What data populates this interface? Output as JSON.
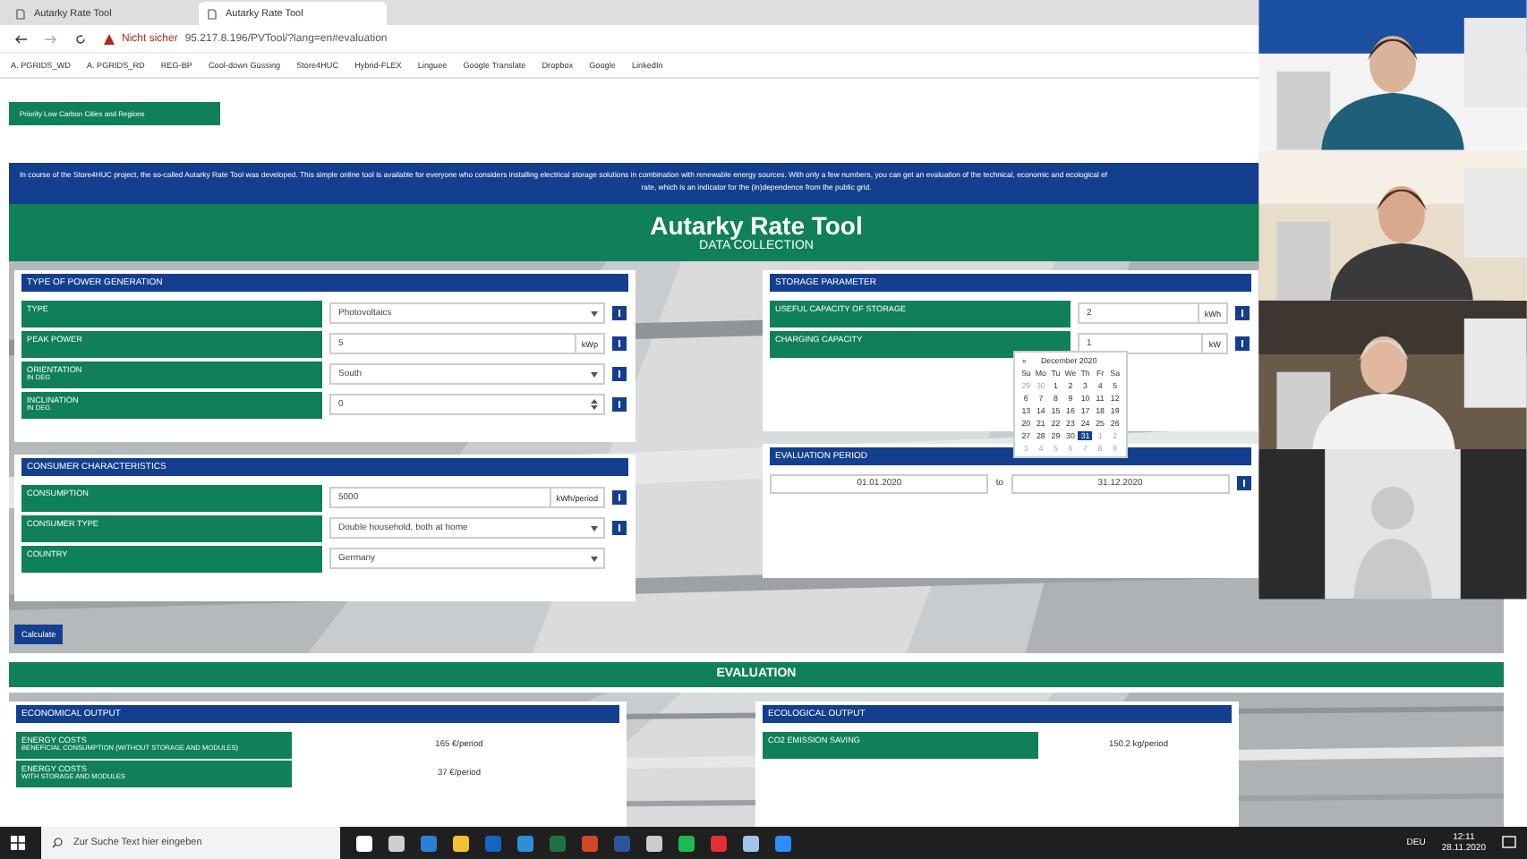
{
  "browser": {
    "tabs": [
      {
        "title": "Autarky Rate Tool",
        "selected": false
      },
      {
        "title": "Autarky Rate Tool",
        "selected": true
      }
    ],
    "security": "Nicht sicher",
    "url": "95.217.8.196/PVTool/?lang=en#evaluation",
    "bookmarks": [
      "A. PGRIDS_WD",
      "A. PGRIDS_RD",
      "REG-BP",
      "Cool-down Güssing",
      "Store4HUC",
      "Hybrid-FLEX",
      "Linguee",
      "Google Translate",
      "Dropbox",
      "Google",
      "LinkedIn"
    ]
  },
  "page": {
    "region_button": "Priority Low Carbon Cities and Regions",
    "intro": [
      "In course of the Store4HUC project, the so-called Autarky Rate Tool was developed. This simple online tool is available for everyone who considers installing electrical storage solutions in combination with renewable energy sources. With only a few numbers, you can get an evaluation of the technical, economic and ecological ef",
      "rate, which is an indicator for the (in)dependence from the public grid."
    ],
    "title": "Autarky Rate Tool",
    "subtitle": "DATA COLLECTION",
    "left_sections": [
      {
        "title": "TYPE OF POWER GENERATION",
        "rows": [
          {
            "kind": "select",
            "label": "TYPE",
            "value": "Photovoltaics",
            "help": true
          },
          {
            "kind": "input",
            "label": "PEAK POWER",
            "value": "5",
            "unit": "kWp",
            "help": true
          },
          {
            "kind": "select",
            "label": "ORIENTATION",
            "sublabel": "IN DEG",
            "value": "South",
            "help": true
          },
          {
            "kind": "spinner",
            "label": "INCLINATION",
            "sublabel": "IN DEG",
            "value": "0",
            "help": true
          }
        ]
      },
      {
        "title": "CONSUMER CHARACTERISTICS",
        "rows": [
          {
            "kind": "input",
            "label": "CONSUMPTION",
            "value": "5000",
            "unit": "kWh/period",
            "help": true
          },
          {
            "kind": "select",
            "label": "CONSUMER TYPE",
            "value": "Double household, both at home",
            "help": true
          },
          {
            "kind": "select",
            "label": "COUNTRY",
            "value": "Germany",
            "help": false
          }
        ]
      }
    ],
    "storage": {
      "title": "STORAGE PARAMETER",
      "rows": [
        {
          "kind": "input",
          "label": "USEFUL CAPACITY OF STORAGE",
          "value": "2",
          "unit": "kWh",
          "help": true
        },
        {
          "kind": "input",
          "label": "CHARGING CAPACITY",
          "value": "1",
          "unit": "kW",
          "help": true
        }
      ]
    },
    "datepicker": {
      "prev": "«",
      "month": "December 2020",
      "weekdays": [
        "Su",
        "Mo",
        "Tu",
        "We",
        "Th",
        "Fr",
        "Sa"
      ],
      "days": [
        {
          "d": "29",
          "other": true,
          "selected": false
        },
        {
          "d": "30",
          "other": true,
          "selected": false
        },
        {
          "d": "1",
          "other": false,
          "selected": false
        },
        {
          "d": "2",
          "other": false,
          "selected": false
        },
        {
          "d": "3",
          "other": false,
          "selected": false
        },
        {
          "d": "4",
          "other": false,
          "selected": false
        },
        {
          "d": "5",
          "other": false,
          "selected": false
        },
        {
          "d": "6",
          "other": false,
          "selected": false
        },
        {
          "d": "7",
          "other": false,
          "selected": false
        },
        {
          "d": "8",
          "other": false,
          "selected": false
        },
        {
          "d": "9",
          "other": false,
          "selected": false
        },
        {
          "d": "10",
          "other": false,
          "selected": false
        },
        {
          "d": "11",
          "other": false,
          "selected": false
        },
        {
          "d": "12",
          "other": false,
          "selected": false
        },
        {
          "d": "13",
          "other": false,
          "selected": false
        },
        {
          "d": "14",
          "other": false,
          "selected": false
        },
        {
          "d": "15",
          "other": false,
          "selected": false
        },
        {
          "d": "16",
          "other": false,
          "selected": false
        },
        {
          "d": "17",
          "other": false,
          "selected": false
        },
        {
          "d": "18",
          "other": false,
          "selected": false
        },
        {
          "d": "19",
          "other": false,
          "selected": false
        },
        {
          "d": "20",
          "other": false,
          "selected": false
        },
        {
          "d": "21",
          "other": false,
          "selected": false
        },
        {
          "d": "22",
          "other": false,
          "selected": false
        },
        {
          "d": "23",
          "other": false,
          "selected": false
        },
        {
          "d": "24",
          "other": false,
          "selected": false
        },
        {
          "d": "25",
          "other": false,
          "selected": false
        },
        {
          "d": "26",
          "other": false,
          "selected": false
        },
        {
          "d": "27",
          "other": false,
          "selected": false
        },
        {
          "d": "28",
          "other": false,
          "selected": false
        },
        {
          "d": "29",
          "other": false,
          "selected": false
        },
        {
          "d": "30",
          "other": false,
          "selected": false
        },
        {
          "d": "31",
          "other": false,
          "selected": true
        },
        {
          "d": "1",
          "other": true,
          "selected": false
        },
        {
          "d": "2",
          "other": true,
          "selected": false
        },
        {
          "d": "3",
          "other": true,
          "selected": false
        },
        {
          "d": "4",
          "other": true,
          "selected": false
        },
        {
          "d": "5",
          "other": true,
          "selected": false
        },
        {
          "d": "6",
          "other": true,
          "selected": false
        },
        {
          "d": "7",
          "other": true,
          "selected": false
        },
        {
          "d": "8",
          "other": true,
          "selected": false
        },
        {
          "d": "9",
          "other": true,
          "selected": false
        }
      ]
    },
    "period": {
      "title": "EVALUATION PERIOD",
      "from": "01.01.2020",
      "to_label": "to",
      "to": "31.12.2020"
    },
    "calculate": "Calculate",
    "evaluation": "EVALUATION",
    "economical": {
      "title": "ECONOMICAL OUTPUT",
      "rows": [
        {
          "label": "ENERGY COSTS",
          "sublabel": "BENEFICIAL CONSUMPTION (WITHOUT STORAGE AND MODULES)",
          "value": "165 €/period"
        },
        {
          "label": "ENERGY COSTS",
          "sublabel": "WITH STORAGE AND MODULES",
          "value": "37 €/period"
        }
      ]
    },
    "ecological": {
      "title": "ECOLOGICAL OUTPUT",
      "rows": [
        {
          "label": "CO2 EMISSION SAVING",
          "value": "150.2 kg/period"
        }
      ]
    }
  },
  "taskbar": {
    "search": "Zur Suche Text hier eingeben",
    "language": "DEU",
    "time": "12:11",
    "date": "28.11.2020"
  }
}
